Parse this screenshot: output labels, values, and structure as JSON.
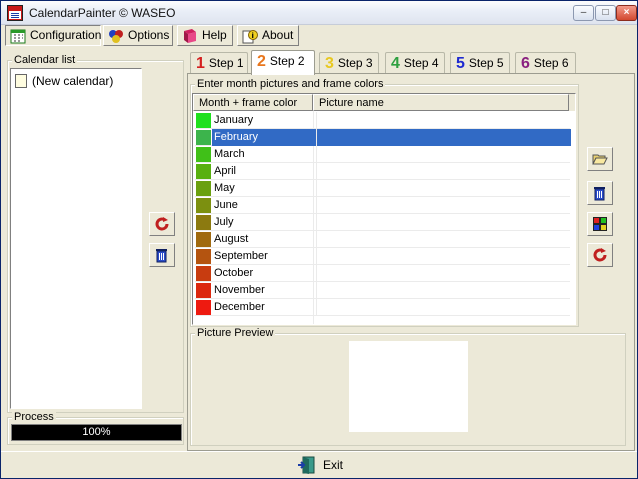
{
  "window": {
    "title": "CalendarPainter © WASEO"
  },
  "toolbar": {
    "configuration": "Configuration",
    "options": "Options",
    "help": "Help",
    "about": "About"
  },
  "calendar_list": {
    "legend": "Calendar list",
    "item": "(New calendar)"
  },
  "process": {
    "legend": "Process",
    "percent": "100%"
  },
  "tabs": [
    {
      "num": "1",
      "label": "Step 1",
      "color": "#d42020"
    },
    {
      "num": "2",
      "label": "Step 2",
      "color": "#e8761c"
    },
    {
      "num": "3",
      "label": "Step 3",
      "color": "#e8c820"
    },
    {
      "num": "4",
      "label": "Step 4",
      "color": "#2ea040"
    },
    {
      "num": "5",
      "label": "Step 5",
      "color": "#1e2ad0"
    },
    {
      "num": "6",
      "label": "Step 6",
      "color": "#8a2080"
    }
  ],
  "month_panel": {
    "legend": "Enter month pictures and frame colors",
    "col_month": "Month + frame color",
    "col_picture": "Picture name",
    "selected_month": "February",
    "months": [
      {
        "name": "January",
        "color": "#1ee01e"
      },
      {
        "name": "February",
        "color": "#3cb44c"
      },
      {
        "name": "March",
        "color": "#40c018"
      },
      {
        "name": "April",
        "color": "#58b010"
      },
      {
        "name": "May",
        "color": "#6aa010"
      },
      {
        "name": "June",
        "color": "#7c9010"
      },
      {
        "name": "July",
        "color": "#8c7a10"
      },
      {
        "name": "August",
        "color": "#a06a10"
      },
      {
        "name": "September",
        "color": "#b45410"
      },
      {
        "name": "October",
        "color": "#c83c10"
      },
      {
        "name": "November",
        "color": "#dc2810"
      },
      {
        "name": "December",
        "color": "#ee1a10"
      }
    ]
  },
  "preview": {
    "legend": "Picture Preview"
  },
  "footer": {
    "exit": "Exit"
  }
}
